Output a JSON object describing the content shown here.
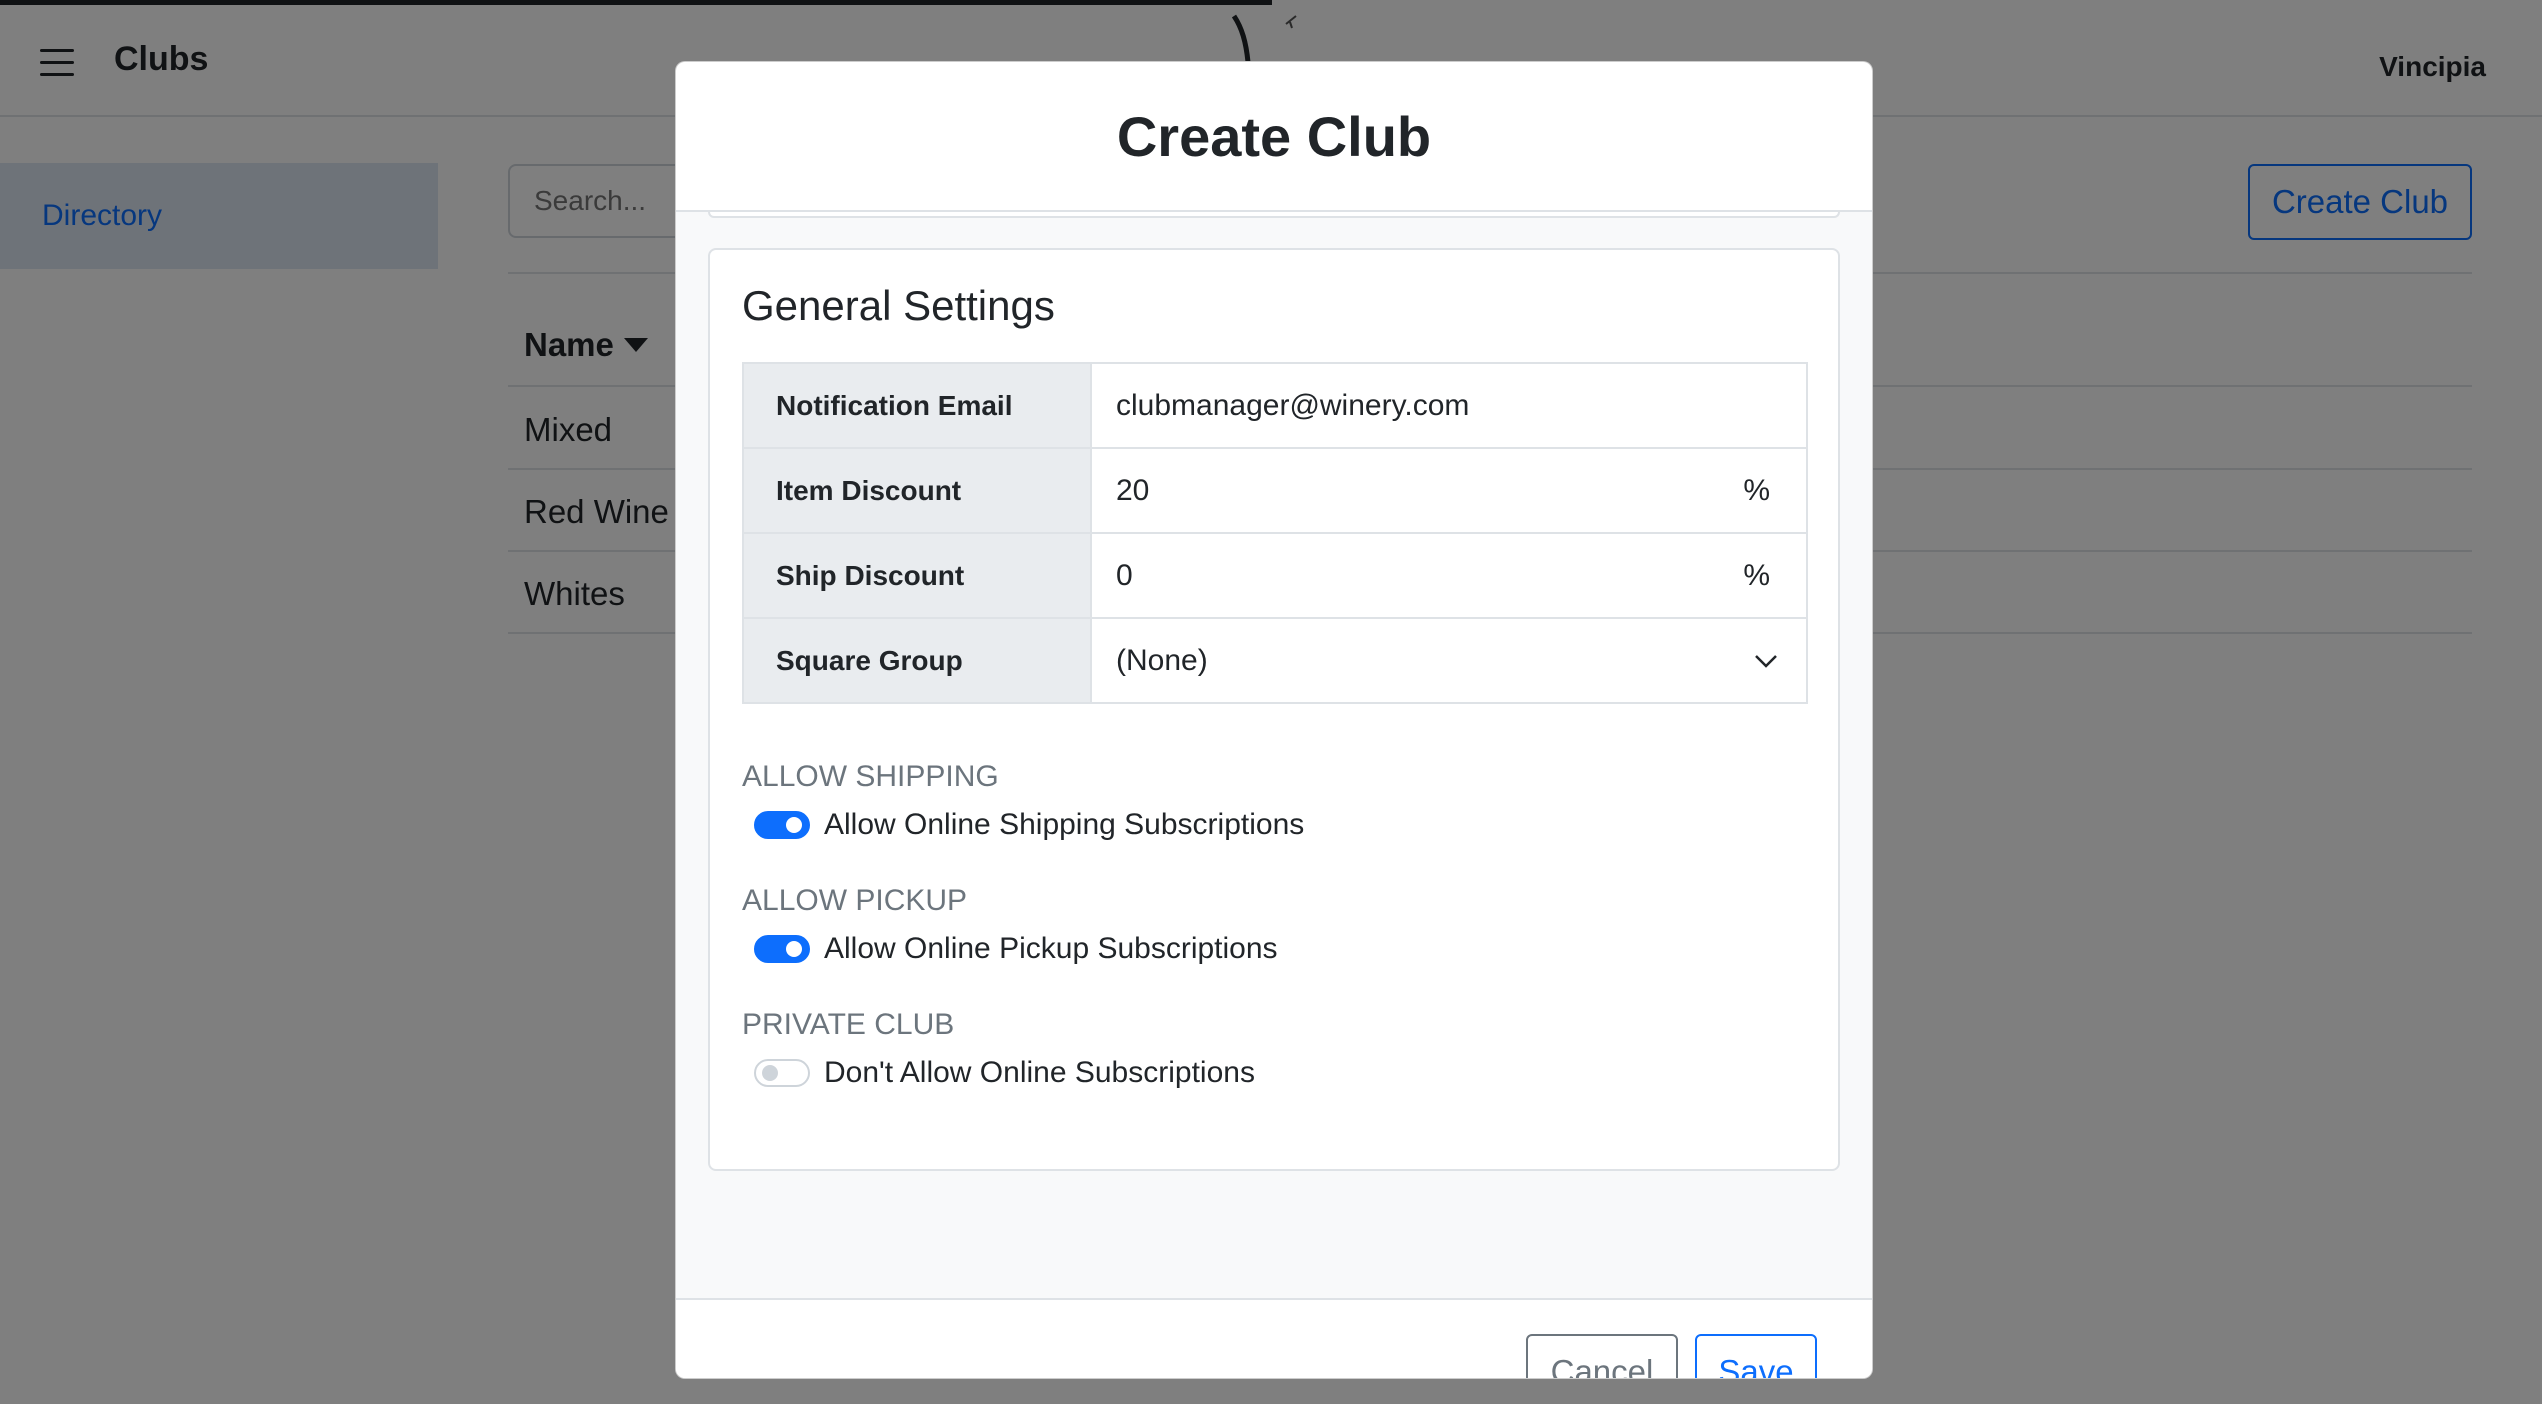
{
  "header": {
    "title": "Clubs",
    "user": "Vincipia"
  },
  "sidebar": {
    "items": [
      {
        "label": "Directory"
      }
    ]
  },
  "toolbar": {
    "search_placeholder": "Search...",
    "create_label": "Create Club"
  },
  "table": {
    "column_header": "Name",
    "rows": [
      {
        "name": "Mixed"
      },
      {
        "name": "Red Wine"
      },
      {
        "name": "Whites"
      }
    ]
  },
  "modal": {
    "title": "Create Club",
    "section_title": "General Settings",
    "fields": [
      {
        "label": "Notification Email",
        "value": "clubmanager@winery.com"
      },
      {
        "label": "Item Discount",
        "value": "20",
        "suffix": "%"
      },
      {
        "label": "Ship Discount",
        "value": "0",
        "suffix": "%"
      },
      {
        "label": "Square Group",
        "value": "(None)"
      }
    ],
    "toggles": [
      {
        "section": "ALLOW SHIPPING",
        "label": "Allow Online Shipping Subscriptions",
        "on": true
      },
      {
        "section": "ALLOW PICKUP",
        "label": "Allow Online Pickup Subscriptions",
        "on": true
      },
      {
        "section": "PRIVATE CLUB",
        "label": "Don't Allow Online Subscriptions",
        "on": false
      }
    ],
    "cancel_label": "Cancel",
    "save_label": "Save"
  },
  "colors": {
    "accent": "#0d6efd",
    "sidebar_active_bg": "#dde6f3",
    "backdrop": "rgba(0,0,0,0.5)"
  }
}
